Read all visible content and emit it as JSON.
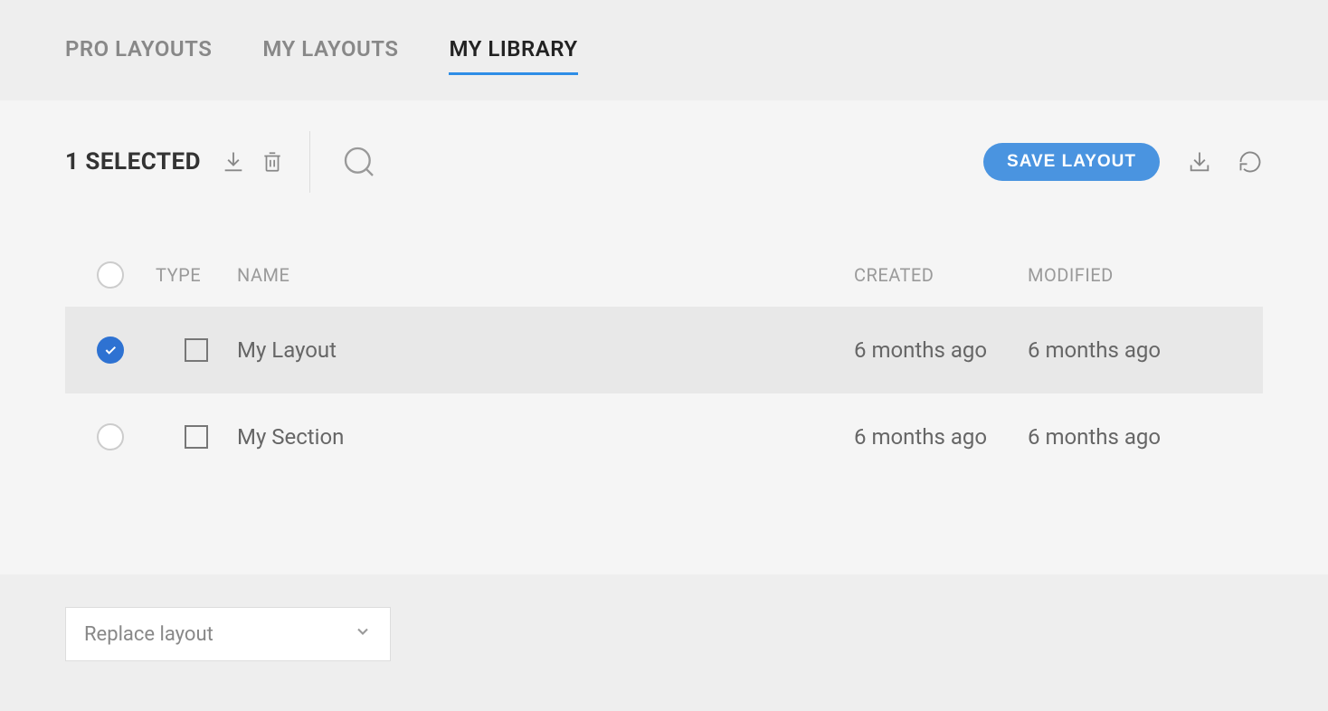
{
  "tabs": [
    {
      "label": "PRO LAYOUTS",
      "active": false
    },
    {
      "label": "MY LAYOUTS",
      "active": false
    },
    {
      "label": "MY LIBRARY",
      "active": true
    }
  ],
  "toolbar": {
    "selected_text": "1 SELECTED",
    "save_label": "SAVE LAYOUT"
  },
  "table": {
    "headers": {
      "type": "TYPE",
      "name": "NAME",
      "created": "CREATED",
      "modified": "MODIFIED"
    },
    "rows": [
      {
        "selected": true,
        "type_icon": "square",
        "name": "My Layout",
        "created": "6 months ago",
        "modified": "6 months ago"
      },
      {
        "selected": false,
        "type_icon": "square",
        "name": "My Section",
        "created": "6 months ago",
        "modified": "6 months ago"
      }
    ]
  },
  "footer": {
    "select_value": "Replace layout"
  }
}
